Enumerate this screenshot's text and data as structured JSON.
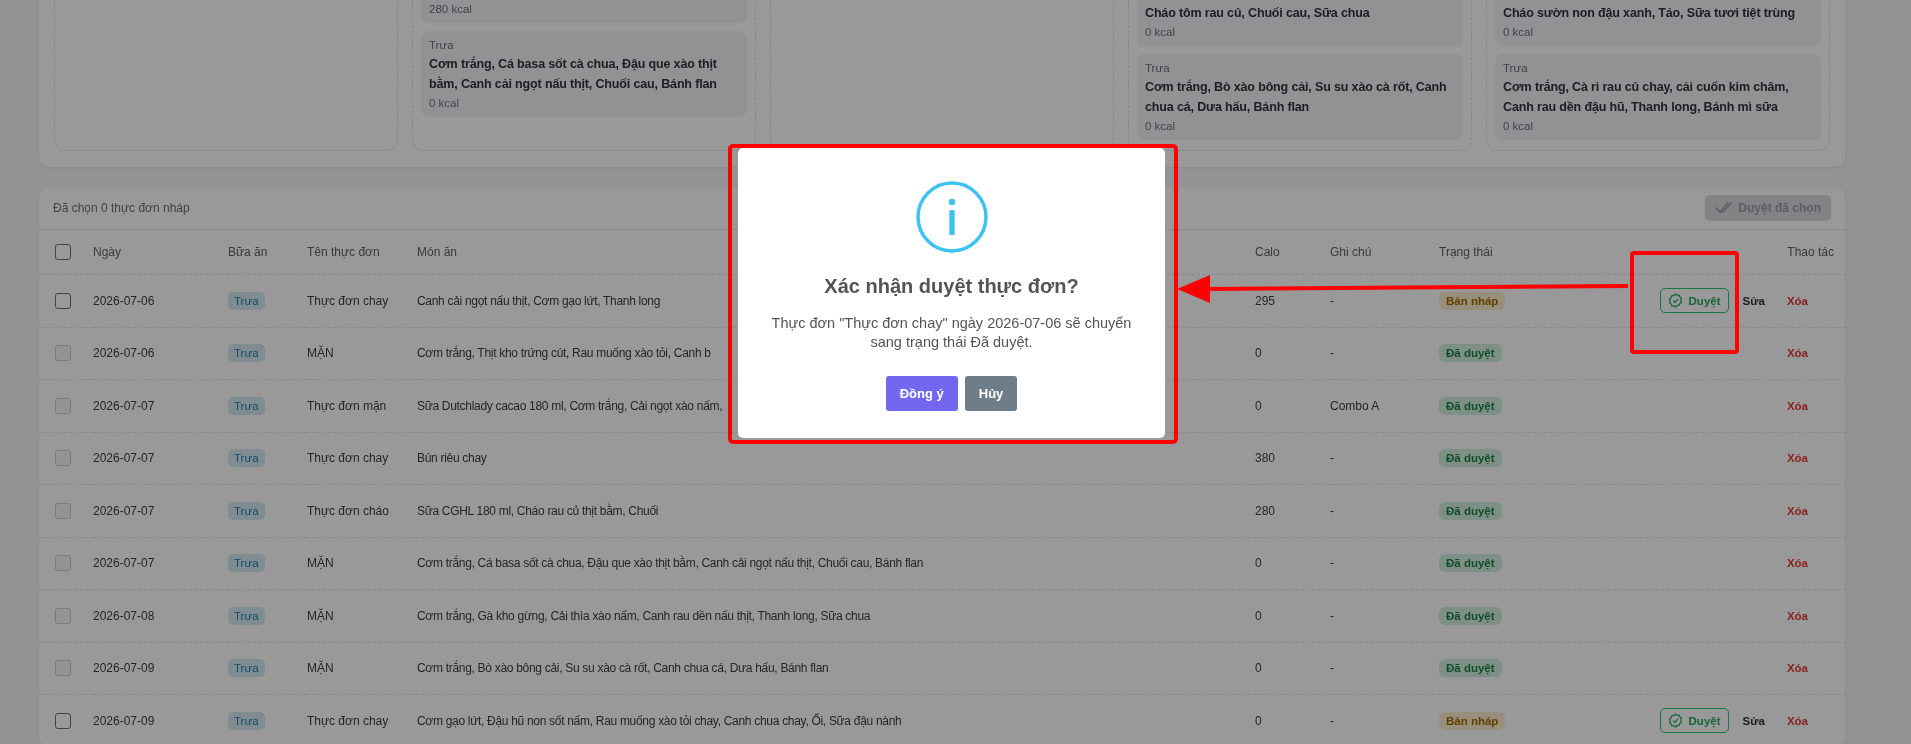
{
  "day_columns": [
    {},
    {
      "meals": [
        {
          "kcal": "280 kcal"
        },
        {
          "meal": "Trưa",
          "dishes": "Cơm trắng, Cá basa sốt cà chua, Đậu que xào thịt bằm, Canh cải ngọt nấu thịt, Chuối cau, Bánh flan",
          "kcal": "0 kcal"
        }
      ]
    },
    {},
    {
      "meals": [
        {
          "dishes": "Cháo tôm rau củ, Chuối cau, Sữa chua",
          "kcal": "0 kcal"
        },
        {
          "meal": "Trưa",
          "dishes": "Cơm trắng, Bò xào bông cải, Su su xào cà rốt, Canh chua cá, Dưa hấu, Bánh flan",
          "kcal": "0 kcal"
        }
      ]
    },
    {
      "meals": [
        {
          "dishes": "Cháo sườn non đậu xanh, Táo, Sữa tươi tiệt trùng",
          "kcal": "0 kcal"
        },
        {
          "meal": "Trưa",
          "dishes": "Cơm trắng, Cà ri rau củ chay, cải cuốn kim châm, Canh rau dền đậu hũ, Thanh long, Bánh mì sữa",
          "kcal": "0 kcal"
        }
      ]
    }
  ],
  "table": {
    "selection_text": "Đã chọn 0 thực đơn nháp",
    "bulk_button": {
      "label": "Duyệt đã chọn",
      "disabled": true
    },
    "header_checkbox": {
      "checked": false
    },
    "columns": [
      "Ngày",
      "Bữa ăn",
      "Tên thực đơn",
      "Món ăn",
      "Calo",
      "Ghi chú",
      "Trạng thái",
      "Thao tác"
    ],
    "rows": [
      {
        "checkbox": {
          "checked": false,
          "disabled": false
        },
        "date": "2026-07-06",
        "meal": "Trưa",
        "menu": "Thực đơn chay",
        "dishes": "Canh cải ngọt nấu thịt, Cơm gạo lứt, Thanh long",
        "calo": "295",
        "note": "-",
        "status": {
          "label": "Bản nháp",
          "kind": "draft"
        },
        "actions": [
          {
            "label": "Duyệt",
            "kind": "approve"
          },
          {
            "label": "Sửa",
            "kind": "edit"
          },
          {
            "label": "Xóa",
            "kind": "delete"
          }
        ]
      },
      {
        "checkbox": {
          "checked": false,
          "disabled": true
        },
        "date": "2026-07-06",
        "meal": "Trưa",
        "menu": "MẶN",
        "dishes": "Cơm trắng, Thịt kho trứng cút, Rau muống xào tỏi, Canh b",
        "calo": "0",
        "note": "-",
        "status": {
          "label": "Đã duyệt",
          "kind": "approved"
        },
        "actions": [
          {
            "label": "Xóa",
            "kind": "delete"
          }
        ]
      },
      {
        "checkbox": {
          "checked": false,
          "disabled": true
        },
        "date": "2026-07-07",
        "meal": "Trưa",
        "menu": "Thực đơn mặn",
        "dishes": "Sữa Dutchlady cacao 180 ml, Cơm trắng, Cải ngọt xào nấm,",
        "calo": "0",
        "note": "Combo A",
        "status": {
          "label": "Đã duyệt",
          "kind": "approved"
        },
        "actions": [
          {
            "label": "Xóa",
            "kind": "delete"
          }
        ]
      },
      {
        "checkbox": {
          "checked": false,
          "disabled": true
        },
        "date": "2026-07-07",
        "meal": "Trưa",
        "menu": "Thực đơn chay",
        "dishes": "Bún riêu chay",
        "calo": "380",
        "note": "-",
        "status": {
          "label": "Đã duyệt",
          "kind": "approved"
        },
        "actions": [
          {
            "label": "Xóa",
            "kind": "delete"
          }
        ]
      },
      {
        "checkbox": {
          "checked": false,
          "disabled": true
        },
        "date": "2026-07-07",
        "meal": "Trưa",
        "menu": "Thực đơn cháo",
        "dishes": "Sữa CGHL 180 ml, Cháo rau củ thịt bằm, Chuối",
        "calo": "280",
        "note": "-",
        "status": {
          "label": "Đã duyệt",
          "kind": "approved"
        },
        "actions": [
          {
            "label": "Xóa",
            "kind": "delete"
          }
        ]
      },
      {
        "checkbox": {
          "checked": false,
          "disabled": true
        },
        "date": "2026-07-07",
        "meal": "Trưa",
        "menu": "MẶN",
        "dishes": "Cơm trắng, Cá basa sốt cà chua, Đậu que xào thịt bằm, Canh cải ngọt nấu thịt, Chuối cau, Bánh flan",
        "calo": "0",
        "note": "-",
        "status": {
          "label": "Đã duyệt",
          "kind": "approved"
        },
        "actions": [
          {
            "label": "Xóa",
            "kind": "delete"
          }
        ]
      },
      {
        "checkbox": {
          "checked": false,
          "disabled": true
        },
        "date": "2026-07-08",
        "meal": "Trưa",
        "menu": "MẶN",
        "dishes": "Cơm trắng, Gà kho gừng, Cải thìa xào nấm, Canh rau dền nấu thịt, Thanh long, Sữa chua",
        "calo": "0",
        "note": "-",
        "status": {
          "label": "Đã duyệt",
          "kind": "approved"
        },
        "actions": [
          {
            "label": "Xóa",
            "kind": "delete"
          }
        ]
      },
      {
        "checkbox": {
          "checked": false,
          "disabled": true
        },
        "date": "2026-07-09",
        "meal": "Trưa",
        "menu": "MẶN",
        "dishes": "Cơm trắng, Bò xào bông cải, Su su xào cà rốt, Canh chua cá, Dưa hấu, Bánh flan",
        "calo": "0",
        "note": "-",
        "status": {
          "label": "Đã duyệt",
          "kind": "approved"
        },
        "actions": [
          {
            "label": "Xóa",
            "kind": "delete"
          }
        ]
      },
      {
        "checkbox": {
          "checked": false,
          "disabled": false
        },
        "date": "2026-07-09",
        "meal": "Trưa",
        "menu": "Thực đơn chay",
        "dishes": "Cơm gạo lứt, Đậu hũ non sốt nấm, Rau muống xào tỏi chay, Canh chua chay, Ổi, Sữa đậu nành",
        "calo": "0",
        "note": "-",
        "status": {
          "label": "Bản nháp",
          "kind": "draft"
        },
        "actions": [
          {
            "label": "Duyệt",
            "kind": "approve"
          },
          {
            "label": "Sửa",
            "kind": "edit"
          },
          {
            "label": "Xóa",
            "kind": "delete"
          }
        ]
      }
    ]
  },
  "dialog": {
    "title": "Xác nhận duyệt thực đơn?",
    "text": "Thực đơn \"Thực đơn chay\" ngày 2026-07-06 sẽ chuyển sang trạng thái Đã duyệt.",
    "confirm": "Đồng ý",
    "cancel": "Hủy"
  }
}
